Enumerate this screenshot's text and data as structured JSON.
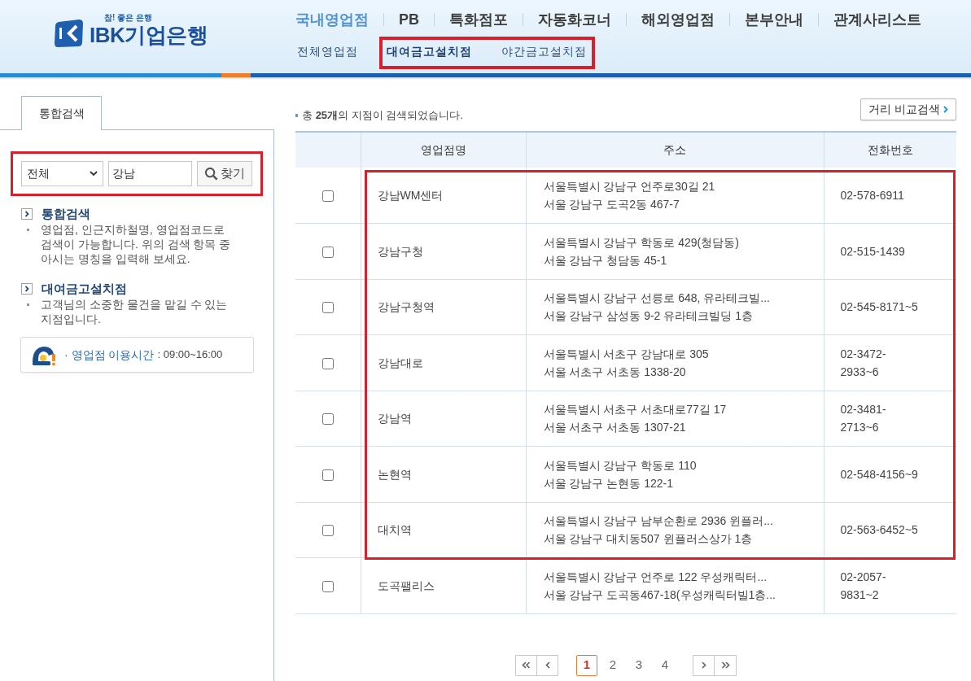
{
  "logo": {
    "tagline": "참! 좋은 은행",
    "name": "IBK기업은행"
  },
  "main_nav": [
    {
      "label": "국내영업점",
      "selected": true
    },
    {
      "label": "PB",
      "selected": false
    },
    {
      "label": "특화점포",
      "selected": false
    },
    {
      "label": "자동화코너",
      "selected": false
    },
    {
      "label": "해외영업점",
      "selected": false
    },
    {
      "label": "본부안내",
      "selected": false
    },
    {
      "label": "관계사리스트",
      "selected": false
    }
  ],
  "sub_nav": [
    {
      "label": "전체영업점",
      "selected": false,
      "highlighted": false
    },
    {
      "label": "대여금고설치점",
      "selected": true,
      "highlighted": true
    },
    {
      "label": "야간금고설치점",
      "selected": false,
      "highlighted": true
    }
  ],
  "sidebar": {
    "tab": "통합검색",
    "search": {
      "highlighted": true,
      "category": "전체",
      "query": "강남",
      "button": "찾기"
    },
    "info": [
      {
        "title": "통합검색",
        "text": "영업점, 인근지하철명, 영업점코드로 검색이 가능합니다. 위의 검색 항목 중 아시는 명칭을 입력해 보세요."
      },
      {
        "title": "대여금고설치점",
        "text": "고객님의 소중한 물건을 맡길 수 있는 지점입니다."
      }
    ],
    "hours": {
      "label": "· 영업점 이용시간",
      "value": ": 09:00~16:00"
    }
  },
  "results": {
    "summary": "총 **25개**의 지점이 검색되었습니다.",
    "compare_button": "거리 비교검색"
  },
  "table": {
    "columns": [
      "영업점명",
      "주소",
      "전화번호"
    ],
    "rows": [
      {
        "checked": false,
        "highlighted": true,
        "name": "강남WM센터",
        "road_address": "서울특별시 강남구 언주로30길 21",
        "lot_address": "서울 강남구 도곡2동 467-7",
        "phone": "02-578-6911"
      },
      {
        "checked": false,
        "highlighted": true,
        "name": "강남구청",
        "road_address": "서울특별시 강남구 학동로 429(청담동)",
        "lot_address": "서울 강남구 청담동 45-1",
        "phone": "02-515-1439"
      },
      {
        "checked": false,
        "highlighted": true,
        "name": "강남구청역",
        "road_address": "서울특별시 강남구 선릉로 648, 유라테크빌...",
        "lot_address": "서울 강남구 삼성동 9-2 유라테크빌딩 1층",
        "phone": "02-545-8171~5"
      },
      {
        "checked": false,
        "highlighted": true,
        "name": "강남대로",
        "road_address": "서울특별시 서초구 강남대로 305",
        "lot_address": "서울 서초구 서초동 1338-20",
        "phone": "02-3472-2933~6"
      },
      {
        "checked": false,
        "highlighted": true,
        "name": "강남역",
        "road_address": "서울특별시 서초구 서초대로77길 17",
        "lot_address": "서울 서초구 서초동 1307-21",
        "phone": "02-3481-2713~6"
      },
      {
        "checked": false,
        "highlighted": true,
        "name": "논현역",
        "road_address": "서울특별시 강남구 학동로 110",
        "lot_address": "서울 강남구 논현동 122-1",
        "phone": "02-548-4156~9"
      },
      {
        "checked": false,
        "highlighted": true,
        "name": "대치역",
        "road_address": "서울특별시 강남구 남부순환로 2936 윈플러...",
        "lot_address": "서울 강남구 대치동507 윈플러스상가 1층",
        "phone": "02-563-6452~5"
      },
      {
        "checked": false,
        "highlighted": false,
        "name": "도곡팰리스",
        "road_address": "서울특별시 강남구 언주로 122 우성캐릭터...",
        "lot_address": "서울 강남구 도곡동467-18(우성캐릭터빌1층...",
        "phone": "02-2057-9831~2"
      }
    ]
  },
  "pagination": {
    "pages": [
      {
        "label": "1",
        "selected": true
      },
      {
        "label": "2",
        "selected": false
      },
      {
        "label": "3",
        "selected": false
      },
      {
        "label": "4",
        "selected": false
      }
    ]
  }
}
